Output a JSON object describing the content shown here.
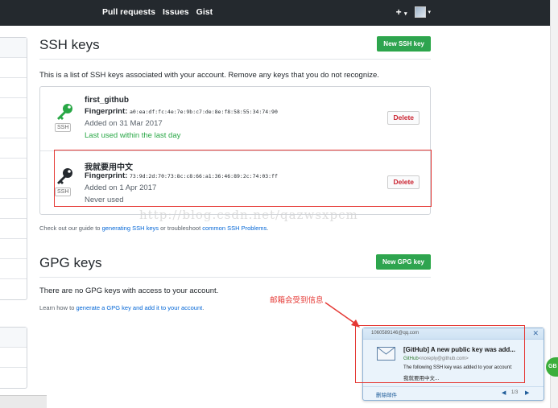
{
  "nav": {
    "pull_requests": "Pull requests",
    "issues": "Issues",
    "gist": "Gist",
    "plus": "+",
    "caret": "▾"
  },
  "ssh": {
    "title": "SSH keys",
    "new_button": "New SSH key",
    "description": "This is a list of SSH keys associated with your account. Remove any keys that you do not recognize.",
    "keys": [
      {
        "name": "first_github",
        "fingerprint_label": "Fingerprint:",
        "fingerprint": "a0:ea:df:fc:4e:7e:9b:c7:de:8e:f8:58:55:34:74:90",
        "added": "Added on 31 Mar 2017",
        "last_used": "Last used within the last day",
        "badge": "SSH",
        "delete_label": "Delete",
        "icon_color": "#28a745"
      },
      {
        "name": "我就要用中文",
        "fingerprint_label": "Fingerprint:",
        "fingerprint": "73:9d:2d:70:73:8c:c8:66:a1:36:46:89:2c:74:03:ff",
        "added": "Added on 1 Apr 2017",
        "last_used": "Never used",
        "badge": "SSH",
        "delete_label": "Delete",
        "icon_color": "#24292e"
      }
    ],
    "guide_prefix": "Check out our guide to ",
    "guide_link1": "generating SSH keys",
    "guide_middle": " or troubleshoot ",
    "guide_link2": "common SSH Problems",
    "guide_suffix": "."
  },
  "gpg": {
    "title": "GPG keys",
    "new_button": "New GPG key",
    "empty_text": "There are no GPG keys with access to your account.",
    "learn_prefix": "Learn how to ",
    "learn_link": "generate a GPG key and add it to your account",
    "learn_suffix": "."
  },
  "watermark": "http://blog.csdn.net/qazwsxpcm",
  "annotation": "邮箱会受到信息",
  "notification": {
    "from": "1060589146@qq.com",
    "close": "✕",
    "subject": "[GitHub] A new public key was add...",
    "sender_name": "GitHub",
    "sender_email": "<noreply@github.com>",
    "body_line1": "The following SSH key was added to your account:",
    "body_line2": "我就要用中文...",
    "delete_label": "删除邮件",
    "prev": "◀",
    "page": "1/3",
    "next": "▶"
  },
  "side_badge": "GB",
  "colors": {
    "navbar": "#24292e",
    "green_button": "#2ea44f",
    "delete_text": "#cb2431",
    "annotation_red": "#e53935",
    "link_blue": "#0366d6"
  }
}
